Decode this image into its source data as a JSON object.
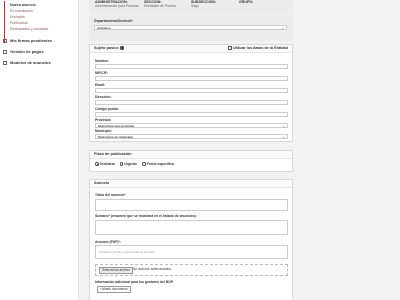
{
  "sidebar": {
    "sub_items": [
      "Nuevo anuncio",
      "En tramitación",
      "Enviados",
      "Publicados",
      "Rechazados y anulados"
    ],
    "main_items": [
      "Mis firmas pendientes",
      "Gestión de pagos",
      "Modelos de anuncios"
    ]
  },
  "header": {
    "administracion_label": "ADMINISTRACIÓN:",
    "administracion_value": "Administración para Pruebas",
    "seccion_label": "SECCIÓN:",
    "seccion_value": "Entidades de Prueba",
    "subseccion_label": "SUBSECCIÓN:",
    "subseccion_value": "Sago",
    "grupo_label": "GRUPO:",
    "grupo_value": ""
  },
  "departamento": {
    "label": "Departamento/Servicio*:",
    "value": "Anuncios"
  },
  "sujeto": {
    "title": "Sujeto pasivo",
    "use_data_label": "Utilizar los datos de la Entidad",
    "fields": [
      "Nombre:",
      "NIF/CIF:",
      "Email:",
      "Dirección:",
      "Código postal:"
    ],
    "provincia_label": "Provincia:",
    "provincia_value": "Seleccione una provincia",
    "municipio_label": "Municipio:",
    "municipio_value": "Seleccione un municipio"
  },
  "plazo": {
    "title": "Plazo de publicación",
    "options": [
      "Ordinaria",
      "Urgente",
      "Fecha específica"
    ]
  },
  "anuncio": {
    "title": "Anuncio",
    "titulo_label": "Título del anuncio*:",
    "sumario_label": "Sumario* (resumen que se mostrará en el listado de anuncios):",
    "pdf_label": "Anuncio (PDF)*:",
    "pdf_placeholder": "Arrastra el archivo para subirlo al anuncio",
    "file_button": "Seleccionar archivo",
    "file_status": "No archivos seleccionados",
    "info_label": "Información adicional para los gestores del BOP",
    "info_button": "+Añadir documento"
  }
}
